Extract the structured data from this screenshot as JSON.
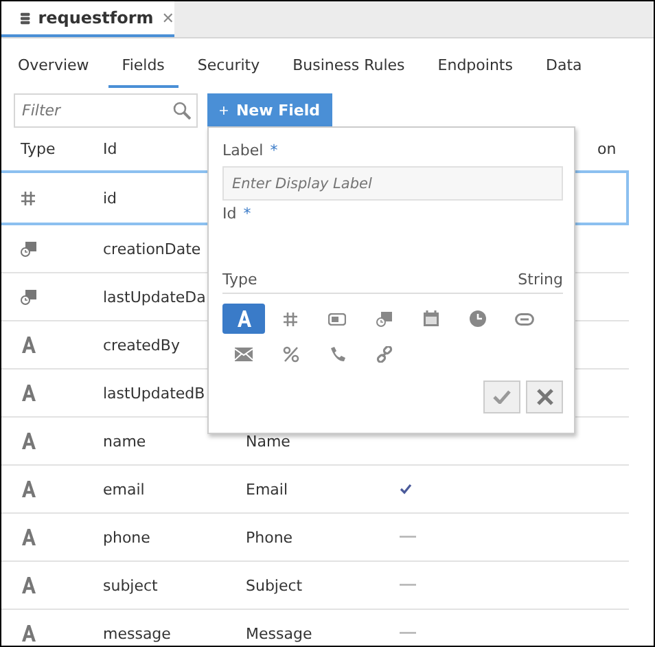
{
  "editor_tab": {
    "title": "requestform",
    "close": "✕"
  },
  "tabs": [
    {
      "label": "Overview",
      "selected": false
    },
    {
      "label": "Fields",
      "selected": true
    },
    {
      "label": "Security",
      "selected": false
    },
    {
      "label": "Business Rules",
      "selected": false
    },
    {
      "label": "Endpoints",
      "selected": false
    },
    {
      "label": "Data",
      "selected": false
    }
  ],
  "filter": {
    "placeholder": "Filter"
  },
  "new_field_button": {
    "label": "New Field"
  },
  "table": {
    "columns": [
      "Type",
      "Id",
      "on"
    ],
    "rows": [
      {
        "kind": "number",
        "id": "id",
        "selected": true
      },
      {
        "kind": "datetime",
        "id": "creationDate",
        "selected": false
      },
      {
        "kind": "datetime",
        "id": "lastUpdateDa",
        "selected": false
      },
      {
        "kind": "string",
        "id": "createdBy",
        "selected": false
      },
      {
        "kind": "string",
        "id": "lastUpdatedB",
        "selected": false
      },
      {
        "kind": "string",
        "id": "name",
        "label": "Name",
        "selected": false
      },
      {
        "kind": "string",
        "id": "email",
        "label": "Email",
        "checked": true,
        "selected": false
      },
      {
        "kind": "string",
        "id": "phone",
        "label": "Phone",
        "checked": false,
        "selected": false
      },
      {
        "kind": "string",
        "id": "subject",
        "label": "Subject",
        "checked": false,
        "selected": false
      },
      {
        "kind": "string",
        "id": "message",
        "label": "Message",
        "checked": false,
        "selected": false
      }
    ]
  },
  "popup": {
    "label_field": {
      "label": "Label",
      "required": "*",
      "placeholder": "Enter Display Label"
    },
    "id_field": {
      "label": "Id",
      "required": "*"
    },
    "type_label": "Type",
    "type_value": "String",
    "types": [
      {
        "kind": "string",
        "selected": true
      },
      {
        "kind": "number",
        "selected": false
      },
      {
        "kind": "toggle",
        "selected": false
      },
      {
        "kind": "datetime",
        "selected": false
      },
      {
        "kind": "date",
        "selected": false
      },
      {
        "kind": "time",
        "selected": false
      },
      {
        "kind": "link",
        "selected": false
      },
      {
        "kind": "email",
        "selected": false
      },
      {
        "kind": "percent",
        "selected": false
      },
      {
        "kind": "phone",
        "selected": false
      },
      {
        "kind": "chain",
        "selected": false
      }
    ]
  }
}
